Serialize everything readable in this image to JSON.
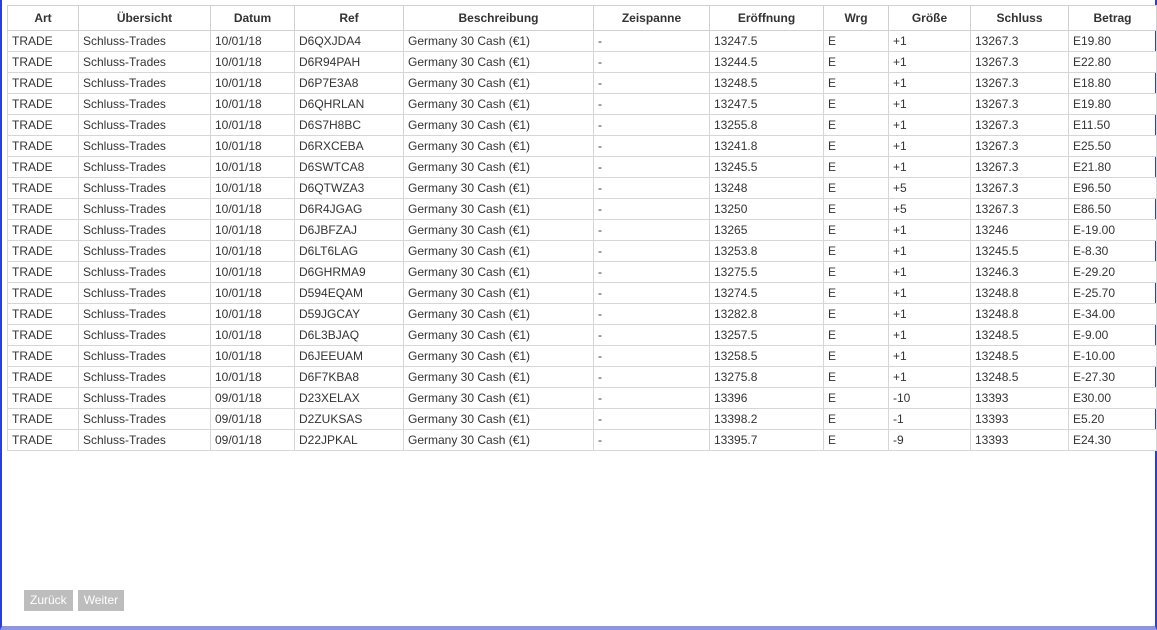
{
  "table": {
    "columns": [
      "Art",
      "Übersicht",
      "Datum",
      "Ref",
      "Beschreibung",
      "Zeispanne",
      "Eröffnung",
      "Wrg",
      "Größe",
      "Schluss",
      "Betrag"
    ],
    "rows": [
      [
        "TRADE",
        "Schluss-Trades",
        "10/01/18",
        "D6QXJDA4",
        "Germany 30 Cash (€1)",
        "-",
        "13247.5",
        "E",
        "+1",
        "13267.3",
        "E19.80"
      ],
      [
        "TRADE",
        "Schluss-Trades",
        "10/01/18",
        "D6R94PAH",
        "Germany 30 Cash (€1)",
        "-",
        "13244.5",
        "E",
        "+1",
        "13267.3",
        "E22.80"
      ],
      [
        "TRADE",
        "Schluss-Trades",
        "10/01/18",
        "D6P7E3A8",
        "Germany 30 Cash (€1)",
        "-",
        "13248.5",
        "E",
        "+1",
        "13267.3",
        "E18.80"
      ],
      [
        "TRADE",
        "Schluss-Trades",
        "10/01/18",
        "D6QHRLAN",
        "Germany 30 Cash (€1)",
        "-",
        "13247.5",
        "E",
        "+1",
        "13267.3",
        "E19.80"
      ],
      [
        "TRADE",
        "Schluss-Trades",
        "10/01/18",
        "D6S7H8BC",
        "Germany 30 Cash (€1)",
        "-",
        "13255.8",
        "E",
        "+1",
        "13267.3",
        "E11.50"
      ],
      [
        "TRADE",
        "Schluss-Trades",
        "10/01/18",
        "D6RXCEBA",
        "Germany 30 Cash (€1)",
        "-",
        "13241.8",
        "E",
        "+1",
        "13267.3",
        "E25.50"
      ],
      [
        "TRADE",
        "Schluss-Trades",
        "10/01/18",
        "D6SWTCA8",
        "Germany 30 Cash (€1)",
        "-",
        "13245.5",
        "E",
        "+1",
        "13267.3",
        "E21.80"
      ],
      [
        "TRADE",
        "Schluss-Trades",
        "10/01/18",
        "D6QTWZA3",
        "Germany 30 Cash (€1)",
        "-",
        "13248",
        "E",
        "+5",
        "13267.3",
        "E96.50"
      ],
      [
        "TRADE",
        "Schluss-Trades",
        "10/01/18",
        "D6R4JGAG",
        "Germany 30 Cash (€1)",
        "-",
        "13250",
        "E",
        "+5",
        "13267.3",
        "E86.50"
      ],
      [
        "TRADE",
        "Schluss-Trades",
        "10/01/18",
        "D6JBFZAJ",
        "Germany 30 Cash (€1)",
        "-",
        "13265",
        "E",
        "+1",
        "13246",
        "E-19.00"
      ],
      [
        "TRADE",
        "Schluss-Trades",
        "10/01/18",
        "D6LT6LAG",
        "Germany 30 Cash (€1)",
        "-",
        "13253.8",
        "E",
        "+1",
        "13245.5",
        "E-8.30"
      ],
      [
        "TRADE",
        "Schluss-Trades",
        "10/01/18",
        "D6GHRMA9",
        "Germany 30 Cash (€1)",
        "-",
        "13275.5",
        "E",
        "+1",
        "13246.3",
        "E-29.20"
      ],
      [
        "TRADE",
        "Schluss-Trades",
        "10/01/18",
        "D594EQAM",
        "Germany 30 Cash (€1)",
        "-",
        "13274.5",
        "E",
        "+1",
        "13248.8",
        "E-25.70"
      ],
      [
        "TRADE",
        "Schluss-Trades",
        "10/01/18",
        "D59JGCAY",
        "Germany 30 Cash (€1)",
        "-",
        "13282.8",
        "E",
        "+1",
        "13248.8",
        "E-34.00"
      ],
      [
        "TRADE",
        "Schluss-Trades",
        "10/01/18",
        "D6L3BJAQ",
        "Germany 30 Cash (€1)",
        "-",
        "13257.5",
        "E",
        "+1",
        "13248.5",
        "E-9.00"
      ],
      [
        "TRADE",
        "Schluss-Trades",
        "10/01/18",
        "D6JEEUAM",
        "Germany 30 Cash (€1)",
        "-",
        "13258.5",
        "E",
        "+1",
        "13248.5",
        "E-10.00"
      ],
      [
        "TRADE",
        "Schluss-Trades",
        "10/01/18",
        "D6F7KBA8",
        "Germany 30 Cash (€1)",
        "-",
        "13275.8",
        "E",
        "+1",
        "13248.5",
        "E-27.30"
      ],
      [
        "TRADE",
        "Schluss-Trades",
        "09/01/18",
        "D23XELAX",
        "Germany 30 Cash (€1)",
        "-",
        "13396",
        "E",
        "-10",
        "13393",
        "E30.00"
      ],
      [
        "TRADE",
        "Schluss-Trades",
        "09/01/18",
        "D2ZUKSAS",
        "Germany 30 Cash (€1)",
        "-",
        "13398.2",
        "E",
        "-1",
        "13393",
        "E5.20"
      ],
      [
        "TRADE",
        "Schluss-Trades",
        "09/01/18",
        "D22JPKAL",
        "Germany 30 Cash (€1)",
        "-",
        "13395.7",
        "E",
        "-9",
        "13393",
        "E24.30"
      ]
    ]
  },
  "pager": {
    "back_label": "Zurück",
    "next_label": "Weiter"
  },
  "colors": {
    "window_border": "#2b3fd6",
    "button_bg": "#bdbdbd",
    "grid_line": "#d6d6d6"
  }
}
